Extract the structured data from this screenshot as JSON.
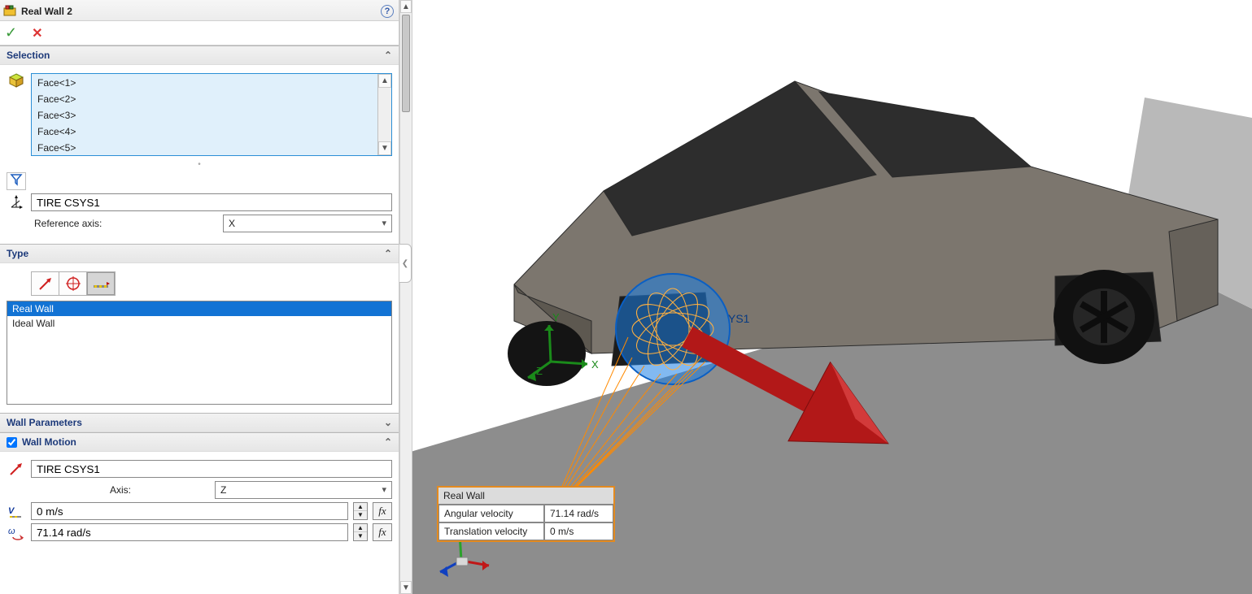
{
  "panel": {
    "title": "Real Wall 2",
    "help": "?",
    "sections": {
      "selection": {
        "label": "Selection",
        "faces": [
          "Face<1>",
          "Face<2>",
          "Face<3>",
          "Face<4>",
          "Face<5>"
        ],
        "csys": "TIRE CSYS1",
        "ref_axis_label": "Reference axis:",
        "ref_axis_value": "X"
      },
      "type": {
        "label": "Type",
        "options": [
          "Real Wall",
          "Ideal Wall"
        ],
        "selected": "Real Wall"
      },
      "wall_params": {
        "label": "Wall Parameters"
      },
      "wall_motion": {
        "label": "Wall Motion",
        "checked": true,
        "csys": "TIRE CSYS1",
        "axis_label": "Axis:",
        "axis_value": "Z",
        "linear_velocity": "0 m/s",
        "angular_velocity": "71.14 rad/s",
        "fx": "fx"
      }
    }
  },
  "viewport": {
    "triad": {
      "x_label": "X",
      "y_label": "Y",
      "z_label": "Z"
    },
    "wheel_label": "YS1",
    "overlay": {
      "title": "Real Wall",
      "rows": [
        {
          "k": "Angular velocity",
          "v": "71.14 rad/s"
        },
        {
          "k": "Translation velocity",
          "v": "0 m/s"
        }
      ]
    }
  }
}
